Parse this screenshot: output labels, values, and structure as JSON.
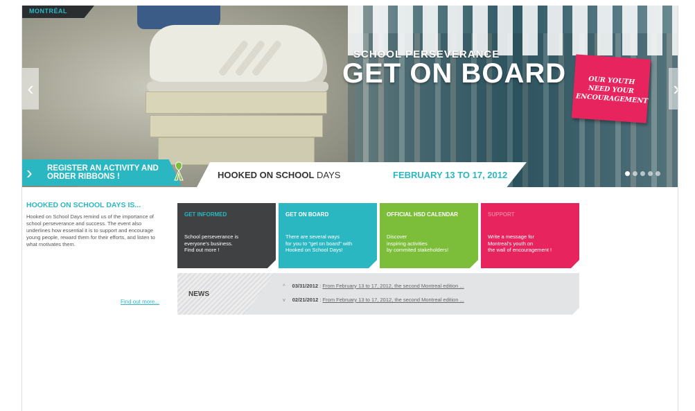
{
  "hero": {
    "city_tag": "MONTRÉAL",
    "subtitle": "SCHOOL PERSEVERANCE",
    "title": "GET ON BOARD !",
    "postit": "OUR YOUTH\nNEED YOUR\nENCOURAGEMENT",
    "prev_glyph": "‹",
    "next_glyph": "›"
  },
  "band": {
    "register_label": "REGISTER AN ACTIVITY AND ORDER RIBBONS !",
    "register_glyph": "›",
    "days_bold": "HOOKED ON SCHOOL",
    "days_light": " DAYS",
    "dates": "FEBRUARY 13 TO 17, 2012",
    "slides": 5,
    "active_slide": 1
  },
  "intro": {
    "title": "HOOKED ON SCHOOL DAYS IS...",
    "text": "Hooked on School Days remind us of the importance of school perseverance and success. The event also underlines how essential it is to support and encourage young people, reward them for their efforts, and listen to what motivates them.",
    "find_more": "Find out more..."
  },
  "cards": [
    {
      "title": "GET INFORMED",
      "text": "School perseverance is\neveryone's business.\nFind out more !",
      "bg": "#3f4142",
      "title_color": "#2bb7c2"
    },
    {
      "title": "GET ON BOARD",
      "text": "There are several ways\nfor you to \"get on board\" with\nHooked on School Days!",
      "bg": "#2bb7c2",
      "title_color": "#ffffff"
    },
    {
      "title": "OFFICIAL HSD CALENDAR",
      "text": "Discover\ninspiring activities\nby commited stakeholders!",
      "bg": "#7cbd3a",
      "title_color": "#ffffff"
    },
    {
      "title": "SUPPORT",
      "text": "Write a message for\nMontreal's youth on\nthe wall of encouragement !",
      "bg": "#e8245e",
      "title_color": "#f27a9a"
    }
  ],
  "news": {
    "label": "NEWS",
    "items": [
      {
        "arrow": "^",
        "date": "03/31/2012",
        "sep": " : ",
        "link": "From February 13 to 17, 2012, the second Montreal edition ..."
      },
      {
        "arrow": "v",
        "date": "02/21/2012",
        "sep": " : ",
        "link": "From February 13 to 17, 2012, the second Montreal edition ..."
      }
    ]
  },
  "colors": {
    "accent": "#2bb7c2",
    "pink": "#e8245e",
    "green": "#7cbd3a",
    "dark": "#3f4142"
  }
}
